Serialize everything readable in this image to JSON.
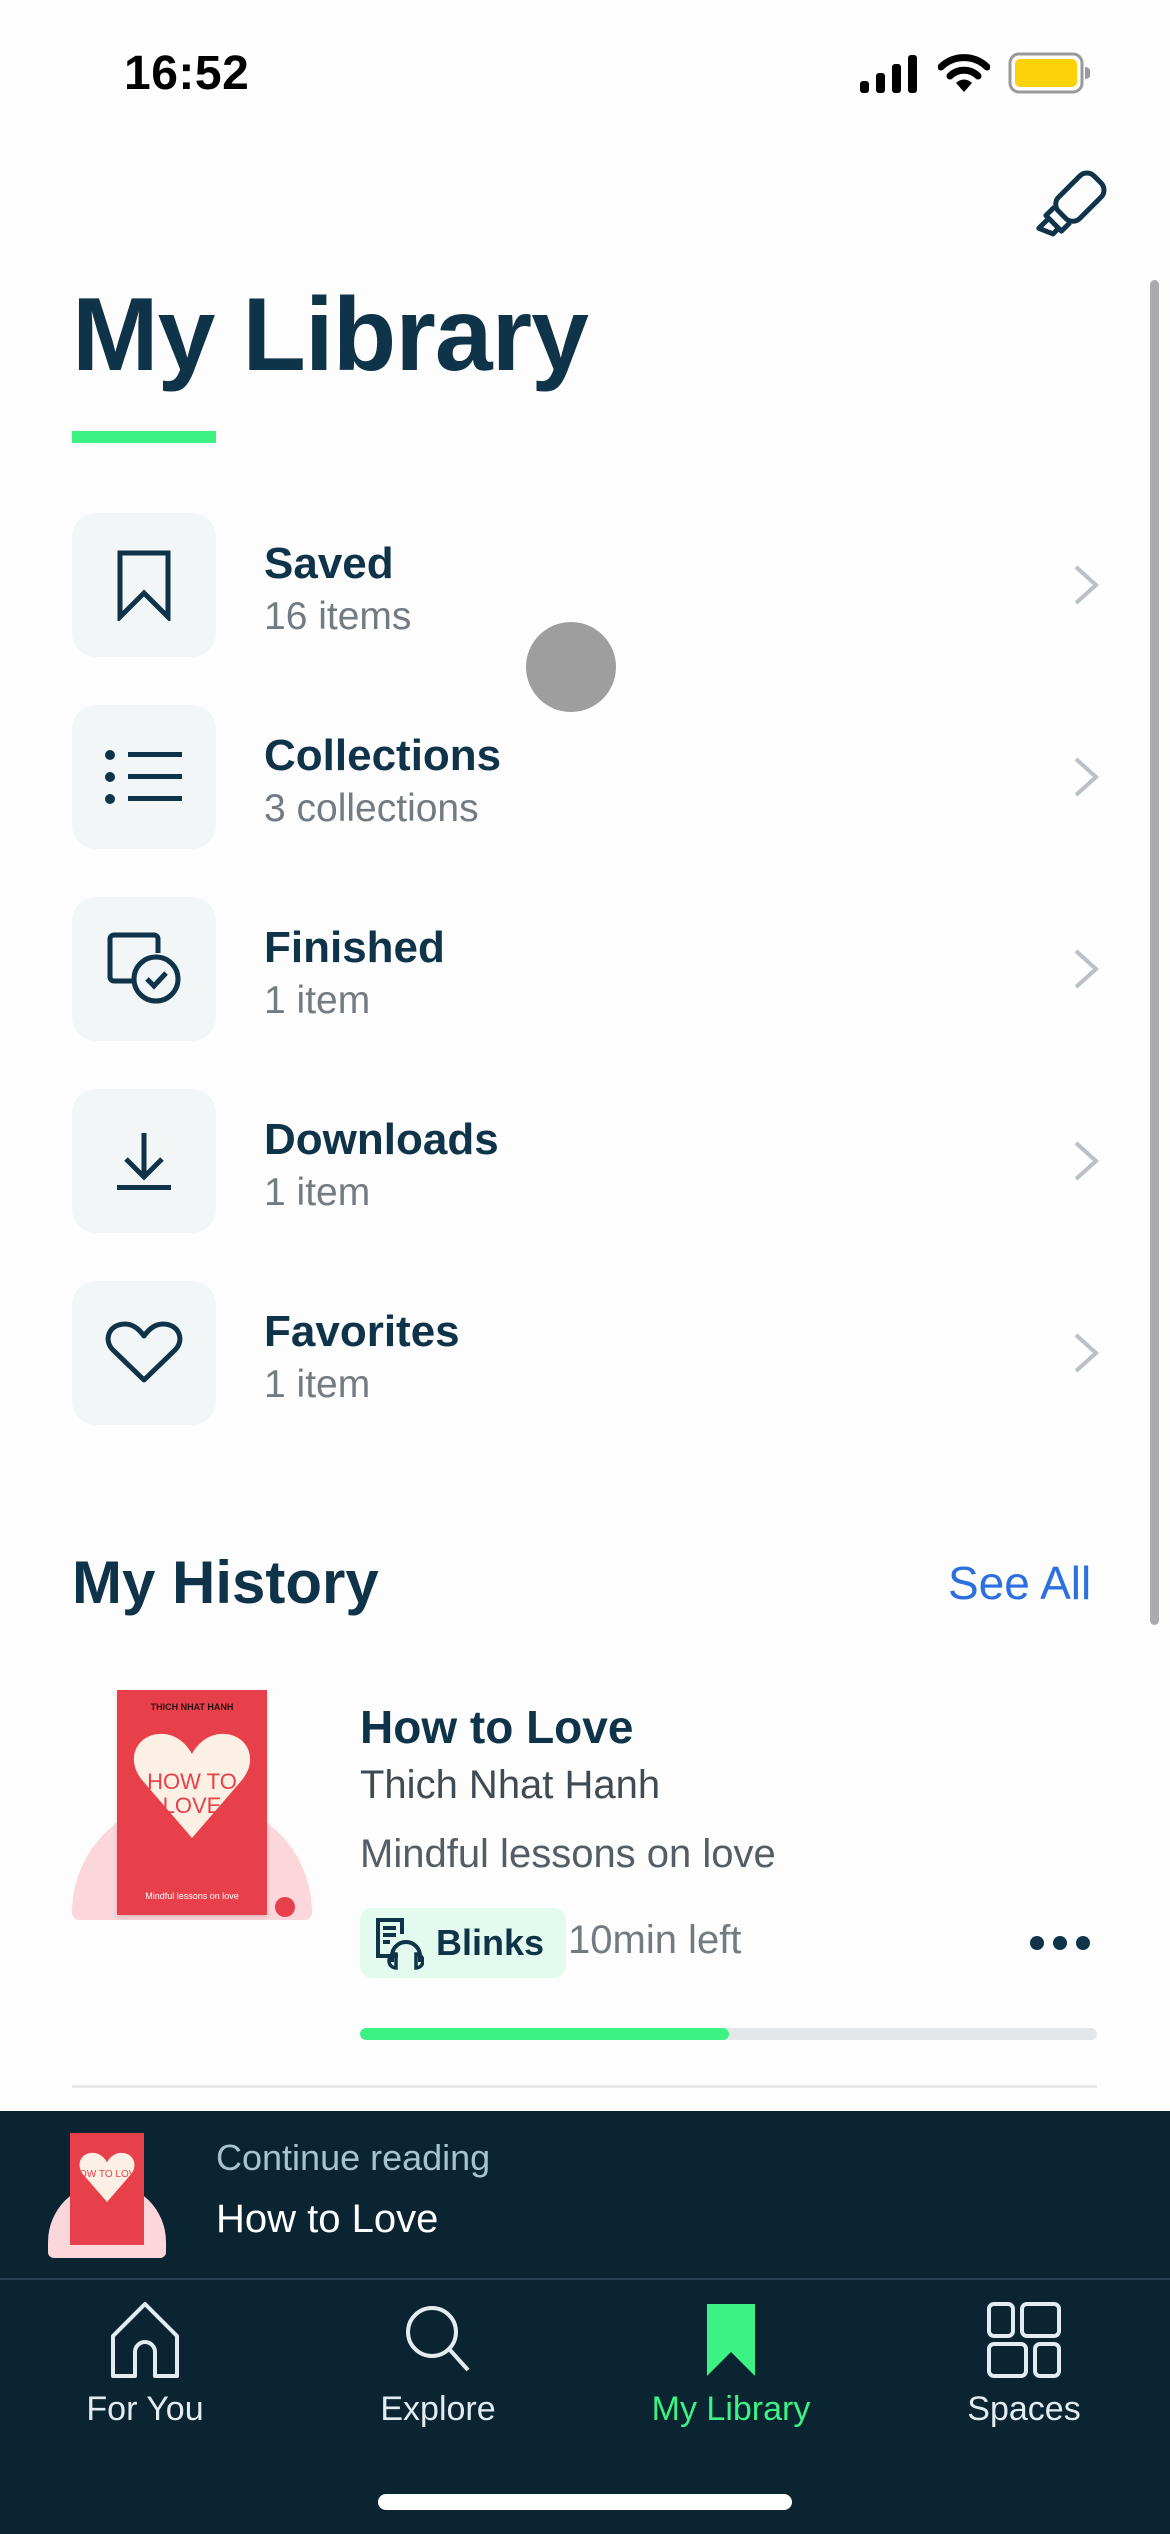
{
  "status_bar": {
    "time": "16:52",
    "icons": [
      "cellular-signal-icon",
      "wifi-icon",
      "battery-icon"
    ],
    "battery_color": "#fcd20a"
  },
  "header": {
    "title": "My Library",
    "action_icon": "highlighter-icon",
    "accent_color": "#3cf283"
  },
  "library": {
    "items": [
      {
        "icon": "bookmark-icon",
        "title": "Saved",
        "subtitle": "16 items"
      },
      {
        "icon": "list-icon",
        "title": "Collections",
        "subtitle": "3 collections"
      },
      {
        "icon": "finished-check-icon",
        "title": "Finished",
        "subtitle": "1 item"
      },
      {
        "icon": "download-icon",
        "title": "Downloads",
        "subtitle": "1 item"
      },
      {
        "icon": "heart-icon",
        "title": "Favorites",
        "subtitle": "1 item"
      }
    ]
  },
  "history": {
    "title": "My History",
    "see_all": "See All",
    "books": [
      {
        "title": "How to Love",
        "author": "Thich Nhat Hanh",
        "description": "Mindful lessons on love",
        "format": "Blinks",
        "time_left": "10min left",
        "progress_percent": 50,
        "cover": {
          "author": "THICH NHAT HANH",
          "title": "HOW TO LOVE",
          "subtitle": "Mindful lessons on love",
          "color": "#e8404a"
        }
      }
    ]
  },
  "mini_player": {
    "label": "Continue reading",
    "book_title": "How to Love",
    "cover_title": "HOW TO LOVE"
  },
  "tab_bar": {
    "active_color": "#3cf283",
    "tabs": [
      {
        "label": "For You",
        "icon": "home-icon",
        "active": false
      },
      {
        "label": "Explore",
        "icon": "search-icon",
        "active": false
      },
      {
        "label": "My Library",
        "icon": "bookmark-filled-icon",
        "active": true
      },
      {
        "label": "Spaces",
        "icon": "grid-icon",
        "active": false
      }
    ]
  }
}
